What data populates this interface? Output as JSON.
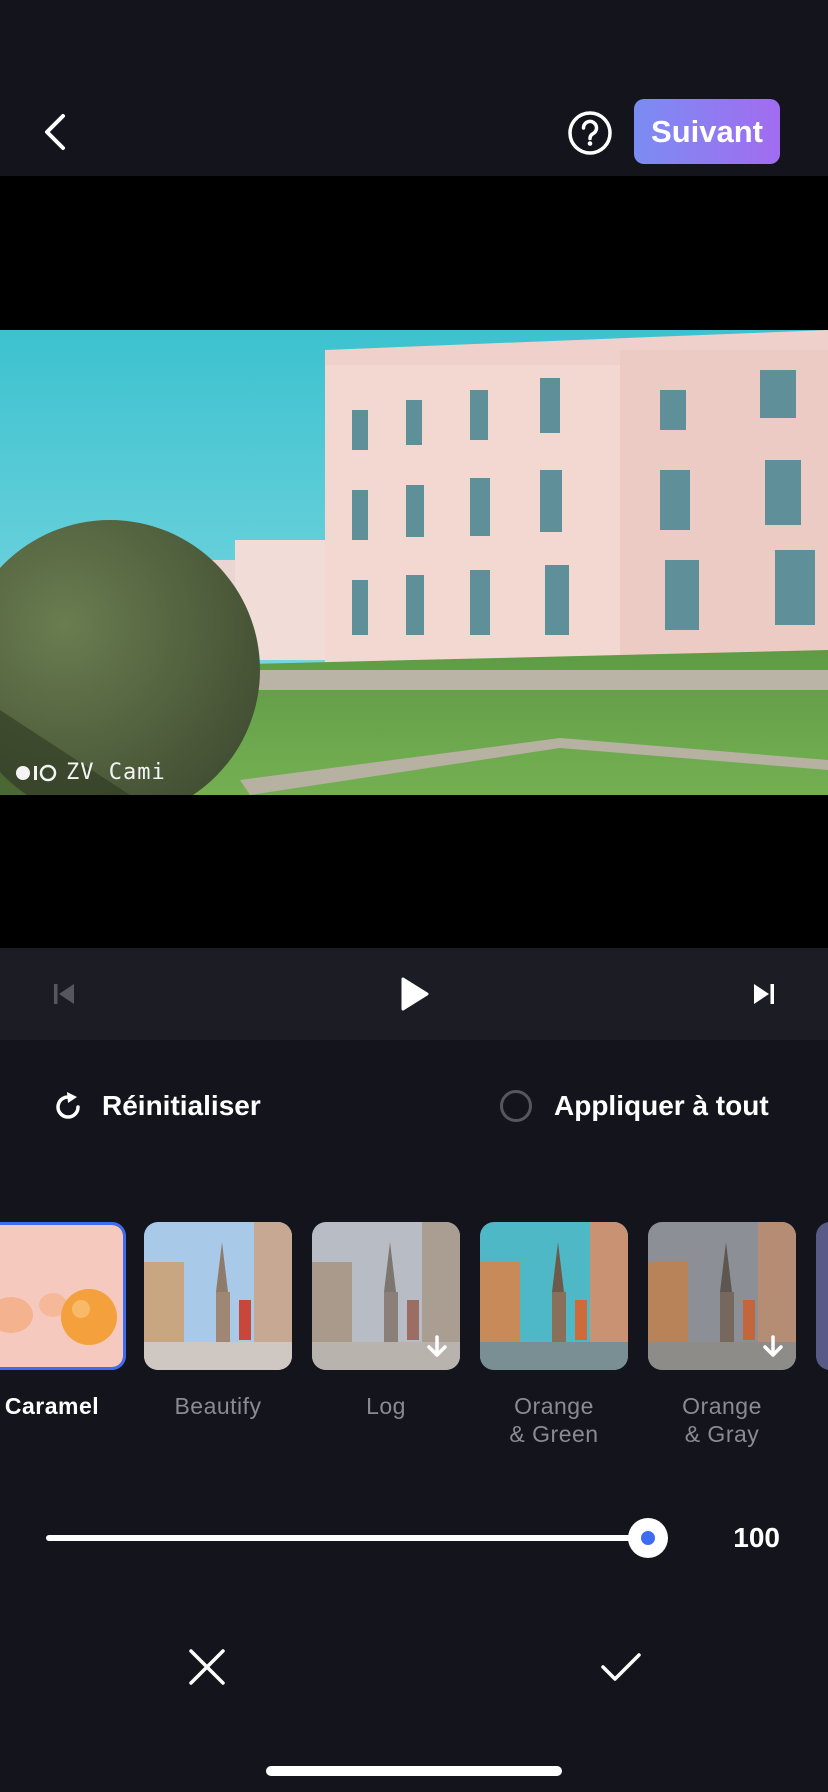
{
  "header": {
    "back_icon": "chevron-left-icon",
    "help_icon": "question-circle-icon",
    "next_label": "Suivant"
  },
  "preview": {
    "watermark": "ZV Cami"
  },
  "transport": {
    "prev_icon": "skip-previous-icon",
    "play_icon": "play-icon",
    "next_icon": "skip-next-icon"
  },
  "options": {
    "reset_label": "Réinitialiser",
    "apply_all_label": "Appliquer à tout"
  },
  "filters": [
    {
      "line1": "Caramel",
      "line2": "",
      "selected": true
    },
    {
      "line1": "Beautify",
      "line2": "",
      "selected": false
    },
    {
      "line1": "Log",
      "line2": "",
      "selected": false,
      "download": true
    },
    {
      "line1": "Orange",
      "line2": "& Green",
      "selected": false
    },
    {
      "line1": "Orange",
      "line2": "& Gray",
      "selected": false,
      "download": true
    }
  ],
  "slider": {
    "value": "100",
    "fraction": 1.0
  },
  "colors": {
    "accent": "#3d6cf1",
    "next_gradient_start": "#7b8cf2",
    "next_gradient_end": "#a26cf0",
    "background": "#14151c"
  }
}
